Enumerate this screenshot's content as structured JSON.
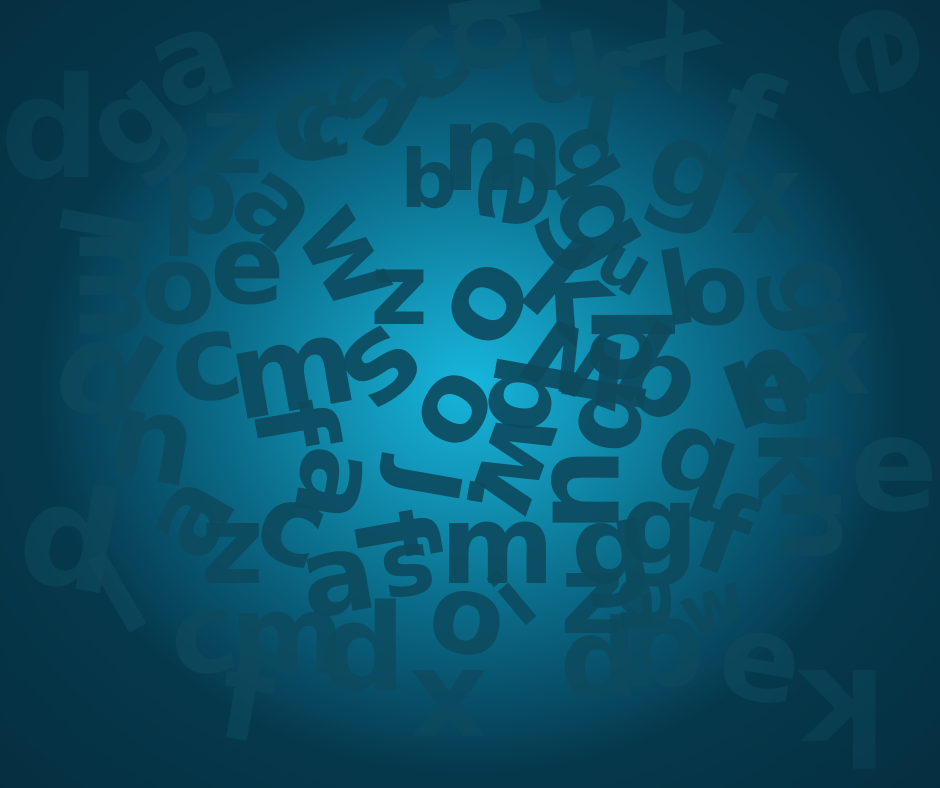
{
  "image": {
    "background_colors": {
      "center": "#17b6dc",
      "mid": "#0b6f8c",
      "edge": "#063a4e"
    },
    "letter_color": "#0d4a5e",
    "letters": [
      "a",
      "z",
      "c",
      "s",
      "c",
      "b",
      "u",
      "f",
      "x",
      "e",
      "d",
      "g",
      "c",
      "j",
      "m",
      "q",
      "g",
      "f",
      "l",
      "p",
      "a",
      "w",
      "b",
      "e",
      "z",
      "g",
      "x",
      "m",
      "o",
      "e",
      "o",
      "k",
      "u",
      "l",
      "o",
      "n",
      "g",
      "d",
      "c",
      "m",
      "s",
      "o",
      "w",
      "b",
      "b",
      "p",
      "e",
      "x",
      "f",
      "a",
      "n",
      "f",
      "j",
      "w",
      "q",
      "b",
      "k",
      "g",
      "a",
      "z",
      "c",
      "u",
      "g",
      "f",
      "e",
      "d",
      "l",
      "a",
      "s",
      "m",
      "z",
      "a",
      "w",
      "n",
      "o",
      "c",
      "m",
      "d",
      "i",
      "e",
      "p",
      "f",
      "q",
      "x",
      "k"
    ]
  }
}
